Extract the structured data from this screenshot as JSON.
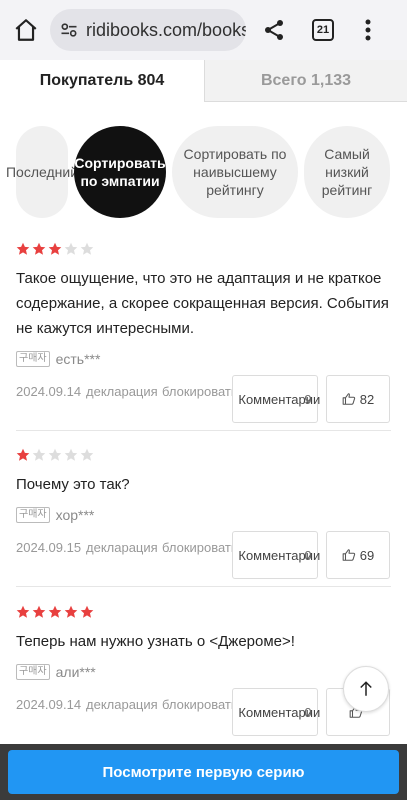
{
  "browser": {
    "url": "ridibooks.com/books",
    "tab_count": "21"
  },
  "tabs": [
    {
      "label": "Покупатель 804"
    },
    {
      "label": "Всего 1,133"
    }
  ],
  "sort_options": [
    {
      "label": "Последний"
    },
    {
      "label": "Сортировать по эмпатии"
    },
    {
      "label": "Сортировать по наивысшему рейтингу"
    },
    {
      "label": "Самый низкий рейтинг"
    }
  ],
  "reviews": [
    {
      "rating": 3,
      "text": "Такое ощущение, что это не адаптация и не краткое содержание, а скорее сокращенная версия. События не кажутся интересными.",
      "badge": "구매자",
      "author": "есть***",
      "date": "2024.09.14",
      "report": "декларация",
      "block": "блокировать",
      "comments_label": "Комментарии",
      "comments_count": "9",
      "likes": "82"
    },
    {
      "rating": 1,
      "text": "Почему это так?",
      "badge": "구매자",
      "author": "хор***",
      "date": "2024.09.15",
      "report": "декларация",
      "block": "блокировать",
      "comments_label": "Комментарии",
      "comments_count": "0",
      "likes": "69"
    },
    {
      "rating": 5,
      "text": "Теперь нам нужно узнать о <Джероме>!",
      "badge": "구매자",
      "author": "али***",
      "date": "2024.09.14",
      "report": "декларация",
      "block": "блокировать",
      "comments_label": "Комментарии",
      "comments_count": "0",
      "likes": ""
    }
  ],
  "cta": {
    "label": "Посмотрите первую серию"
  },
  "colors": {
    "star_on": "#e8403f",
    "star_off": "#dddddd",
    "cta": "#2196f3",
    "chip_active": "#111111"
  },
  "icons": [
    "home-icon",
    "site-settings-icon",
    "share-icon",
    "tab-switcher-icon",
    "more-vert-icon",
    "thumb-up-icon",
    "arrow-up-icon"
  ]
}
